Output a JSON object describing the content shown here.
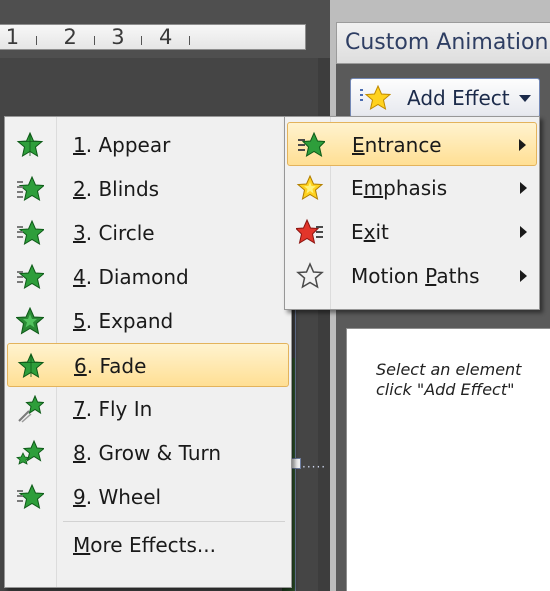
{
  "ruler": {
    "numbers": [
      "1",
      "2",
      "3",
      "4"
    ]
  },
  "task_pane": {
    "title": "Custom Animation",
    "add_effect_label": "Add Effect",
    "hint_line1": "Select an element",
    "hint_line2": "click \"Add Effect\""
  },
  "main_menu": {
    "items": [
      {
        "key": "E",
        "rest": "ntrance",
        "label": "Entrance",
        "icon": "entrance-star-icon",
        "highlighted": true
      },
      {
        "pre": "E",
        "key": "m",
        "rest": "phasis",
        "label": "Emphasis",
        "icon": "emphasis-star-icon"
      },
      {
        "pre": "E",
        "key": "x",
        "rest": "it",
        "label": "Exit",
        "icon": "exit-star-icon"
      },
      {
        "pre": "Motion ",
        "key": "P",
        "rest": "aths",
        "label": "Motion Paths",
        "icon": "motion-path-star-icon"
      }
    ]
  },
  "submenu": {
    "items": [
      {
        "key": "1",
        "rest": ". Appear",
        "label": "1. Appear",
        "icon": "appear-star-icon"
      },
      {
        "key": "2",
        "rest": ". Blinds",
        "label": "2. Blinds",
        "icon": "blinds-star-icon"
      },
      {
        "key": "3",
        "rest": ". Circle",
        "label": "3. Circle",
        "icon": "circle-star-icon"
      },
      {
        "key": "4",
        "rest": ". Diamond",
        "label": "4. Diamond",
        "icon": "diamond-star-icon"
      },
      {
        "key": "5",
        "rest": ". Expand",
        "label": "5. Expand",
        "icon": "expand-star-icon"
      },
      {
        "key": "6",
        "rest": ". Fade",
        "label": "6. Fade",
        "icon": "fade-star-icon",
        "highlighted": true
      },
      {
        "key": "7",
        "rest": ". Fly In",
        "label": "7. Fly In",
        "icon": "fly-in-star-icon"
      },
      {
        "key": "8",
        "rest": ". Grow & Turn",
        "label": "8. Grow & Turn",
        "icon": "grow-turn-star-icon"
      },
      {
        "key": "9",
        "rest": ". Wheel",
        "label": "9. Wheel",
        "icon": "wheel-star-icon"
      }
    ],
    "more": {
      "key": "M",
      "rest": "ore Effects...",
      "label": "More Effects..."
    }
  },
  "colors": {
    "highlight_top": "#fff3cf",
    "highlight_bottom": "#ffdf94",
    "star_green": "#2e9e3b",
    "star_yellow": "#ffd21f",
    "star_red": "#e2352a"
  }
}
